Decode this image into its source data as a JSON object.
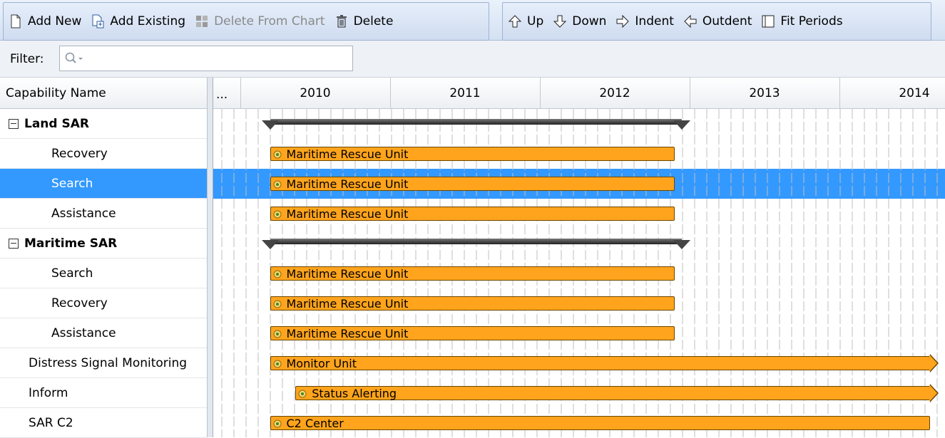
{
  "toolbar": {
    "add_new": "Add New",
    "add_existing": "Add Existing",
    "delete_from_chart": "Delete From Chart",
    "delete": "Delete",
    "up": "Up",
    "down": "Down",
    "indent": "Indent",
    "outdent": "Outdent",
    "fit_periods": "Fit Periods"
  },
  "filter": {
    "label": "Filter:",
    "value": ""
  },
  "table": {
    "column_header": "Capability Name",
    "rows": [
      {
        "name": "Land SAR",
        "level": 0,
        "group": true,
        "selected": false
      },
      {
        "name": "Recovery",
        "level": 1,
        "group": false,
        "selected": false
      },
      {
        "name": "Search",
        "level": 1,
        "group": false,
        "selected": true
      },
      {
        "name": "Assistance",
        "level": 1,
        "group": false,
        "selected": false
      },
      {
        "name": "Maritime SAR",
        "level": 0,
        "group": true,
        "selected": false
      },
      {
        "name": "Search",
        "level": 1,
        "group": false,
        "selected": false
      },
      {
        "name": "Recovery",
        "level": 1,
        "group": false,
        "selected": false
      },
      {
        "name": "Assistance",
        "level": 1,
        "group": false,
        "selected": false
      },
      {
        "name": "Distress Signal Monitoring",
        "level": 0,
        "group": false,
        "selected": false
      },
      {
        "name": "Inform",
        "level": 0,
        "group": false,
        "selected": false
      },
      {
        "name": "SAR C2",
        "level": 0,
        "group": false,
        "selected": false
      }
    ]
  },
  "timeline": {
    "overflow_marker": "...",
    "years": [
      "2010",
      "2011",
      "2012",
      "2013",
      "2014"
    ],
    "bars": [
      {
        "row": 0,
        "summary": true,
        "start": 2009.65,
        "end": 2012.4
      },
      {
        "row": 1,
        "label": "Maritime Rescue Unit",
        "start": 2009.65,
        "end": 2012.35
      },
      {
        "row": 2,
        "label": "Maritime Rescue Unit",
        "start": 2009.65,
        "end": 2012.35
      },
      {
        "row": 3,
        "label": "Maritime Rescue Unit",
        "start": 2009.65,
        "end": 2012.35
      },
      {
        "row": 4,
        "summary": true,
        "start": 2009.65,
        "end": 2012.4
      },
      {
        "row": 5,
        "label": "Maritime Rescue Unit",
        "start": 2009.65,
        "end": 2012.35
      },
      {
        "row": 6,
        "label": "Maritime Rescue Unit",
        "start": 2009.65,
        "end": 2012.35
      },
      {
        "row": 7,
        "label": "Maritime Rescue Unit",
        "start": 2009.65,
        "end": 2012.35
      },
      {
        "row": 8,
        "label": "Monitor Unit",
        "start": 2009.65,
        "end": 2015,
        "open_end": true
      },
      {
        "row": 9,
        "label": "Status Alerting",
        "start": 2009.82,
        "end": 2015,
        "open_end": true
      },
      {
        "row": 10,
        "label": "C2 Center",
        "start": 2009.65,
        "end": 2014.52
      }
    ]
  },
  "colors": {
    "selection": "#3399ff",
    "bar_fill": "#ffa41c",
    "bar_border": "#6b4600"
  },
  "icons": {
    "add_new": "new-document-icon",
    "add_existing": "add-existing-icon",
    "delete_from_chart": "delete-from-chart-icon",
    "delete": "trash-icon",
    "up": "arrow-up-icon",
    "down": "arrow-down-icon",
    "indent": "arrow-right-icon",
    "outdent": "arrow-left-icon",
    "fit_periods": "fit-periods-icon",
    "filter": "search-icon"
  }
}
